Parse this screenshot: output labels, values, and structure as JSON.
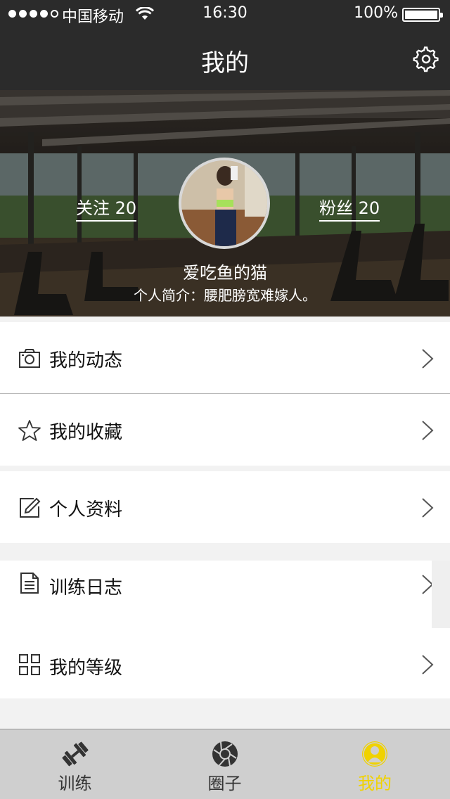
{
  "status_bar": {
    "carrier": "中国移动",
    "time": "16:30",
    "battery": "100%"
  },
  "nav": {
    "title": "我的",
    "settings_icon": "gear-icon"
  },
  "profile": {
    "follow_label": "关注 20",
    "fans_label": "粉丝 20",
    "username": "爱吃鱼的猫",
    "bio": "个人简介：腰肥膀宽难嫁人。"
  },
  "menu": [
    {
      "label": "我的动态",
      "icon": "camera-icon"
    },
    {
      "label": "我的收藏",
      "icon": "star-icon"
    },
    {
      "label": "个人资料",
      "icon": "edit-icon"
    },
    {
      "label": "训练日志",
      "icon": "document-icon"
    },
    {
      "label": "我的等级",
      "icon": "grid-icon"
    }
  ],
  "tabs": [
    {
      "label": "训练",
      "icon": "dumbbell-icon"
    },
    {
      "label": "圈子",
      "icon": "aperture-icon"
    },
    {
      "label": "我的",
      "icon": "user-icon"
    }
  ],
  "colors": {
    "header_bg": "#2b2b2b",
    "active_tab": "#f0d200",
    "tabbar_bg": "#cfcfcf"
  }
}
